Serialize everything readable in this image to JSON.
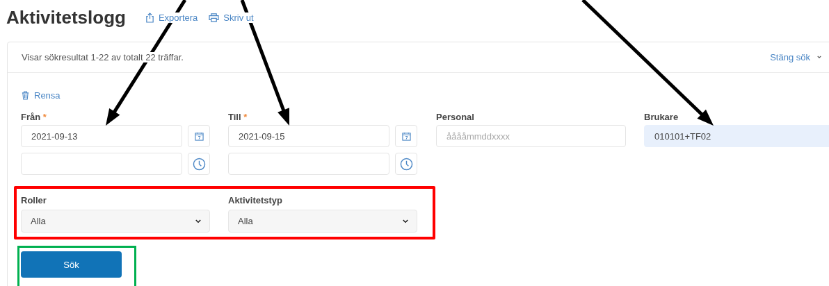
{
  "page": {
    "title": "Aktivitetslogg",
    "actions": [
      {
        "kind": "export",
        "label": "Exportera"
      },
      {
        "kind": "print",
        "label": "Skriv ut"
      }
    ]
  },
  "search_panel": {
    "result_text": "Visar sökresultat 1-22 av totalt 22 träffar.",
    "close_link": "Stäng sök",
    "clear_link": "Rensa",
    "date_fields": [
      {
        "label": "Från",
        "required_mark": "*",
        "date": "2021-09-13"
      },
      {
        "label": "Till",
        "required_mark": "*",
        "date": "2021-09-15"
      }
    ],
    "text_fields": [
      {
        "label": "Personal",
        "placeholder": "ååååmmddxxxx",
        "autofilled": false
      },
      {
        "label": "Brukare",
        "value": "010101+TF02",
        "autofilled": true
      }
    ],
    "selects": [
      {
        "label": "Roller",
        "value": "Alla"
      },
      {
        "label": "Aktivitetstyp",
        "value": "Alla"
      }
    ],
    "search_button": "Sök"
  }
}
